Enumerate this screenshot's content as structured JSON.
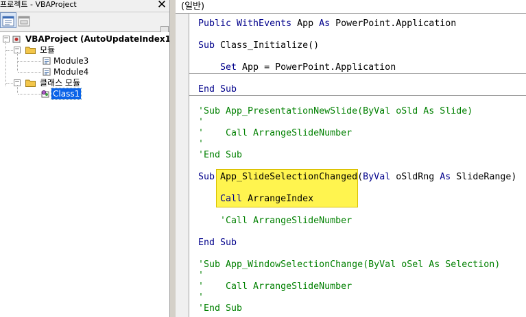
{
  "explorer": {
    "title": "프로젝트 - VBAProject",
    "close_glyph": "✕",
    "toolbar": {
      "view_code": "view-code-icon",
      "view_object": "view-object-icon",
      "toggle_folders": "folder-icon"
    },
    "tree": {
      "project": "VBAProject (AutoUpdateIndex1.",
      "modules_folder": "모듈",
      "modules": [
        "Module3",
        "Module4"
      ],
      "class_modules_folder": "클래스 모듈",
      "class_modules": [
        "Class1"
      ],
      "selected": "Class1"
    }
  },
  "code_window": {
    "procedure_combo": "(일반)",
    "lines": [
      [
        {
          "t": "Public WithEvents ",
          "c": "kw"
        },
        {
          "t": "App ",
          "c": ""
        },
        {
          "t": "As ",
          "c": "kw"
        },
        {
          "t": "PowerPoint.Application",
          "c": ""
        }
      ],
      [
        {
          "t": "Sub ",
          "c": "kw"
        },
        {
          "t": "Class_Initialize()",
          "c": ""
        }
      ],
      [
        {
          "t": "    Set ",
          "c": "kw"
        },
        {
          "t": "App = PowerPoint.Application",
          "c": ""
        }
      ],
      [
        {
          "t": "End Sub",
          "c": "kw"
        }
      ],
      [
        {
          "t": "'Sub App_PresentationNewSlide(ByVal oSld As Slide)",
          "c": "cm"
        }
      ],
      [
        {
          "t": "'",
          "c": "cm"
        }
      ],
      [
        {
          "t": "'    Call ArrangeSlideNumber",
          "c": "cm"
        }
      ],
      [
        {
          "t": "'",
          "c": "cm"
        }
      ],
      [
        {
          "t": "'End Sub",
          "c": "cm"
        }
      ],
      [
        {
          "t": "Sub ",
          "c": "kw"
        },
        {
          "t": "App_SlideSelectionChanged(",
          "c": ""
        },
        {
          "t": "ByVal ",
          "c": "kw"
        },
        {
          "t": "oSldRng ",
          "c": ""
        },
        {
          "t": "As ",
          "c": "kw"
        },
        {
          "t": "SlideRange)",
          "c": ""
        }
      ],
      [
        {
          "t": "    Call ",
          "c": "kw"
        },
        {
          "t": "ArrangeIndex",
          "c": ""
        }
      ],
      [
        {
          "t": "    'Call ArrangeSlideNumber",
          "c": "cm"
        }
      ],
      [
        {
          "t": "End Sub",
          "c": "kw"
        }
      ],
      [
        {
          "t": "'Sub App_WindowSelectionChange(ByVal oSel As Selection)",
          "c": "cm"
        }
      ],
      [
        {
          "t": "'",
          "c": "cm"
        }
      ],
      [
        {
          "t": "'    Call ArrangeSlideNumber",
          "c": "cm"
        }
      ],
      [
        {
          "t": "'",
          "c": "cm"
        }
      ],
      [
        {
          "t": "'End Sub",
          "c": "cm"
        }
      ]
    ],
    "highlight_note": "yellow-highlight",
    "colors": {
      "keyword": "#00008b",
      "comment": "#008000",
      "highlight": "#fff44f",
      "selection": "#0a63e8"
    }
  }
}
